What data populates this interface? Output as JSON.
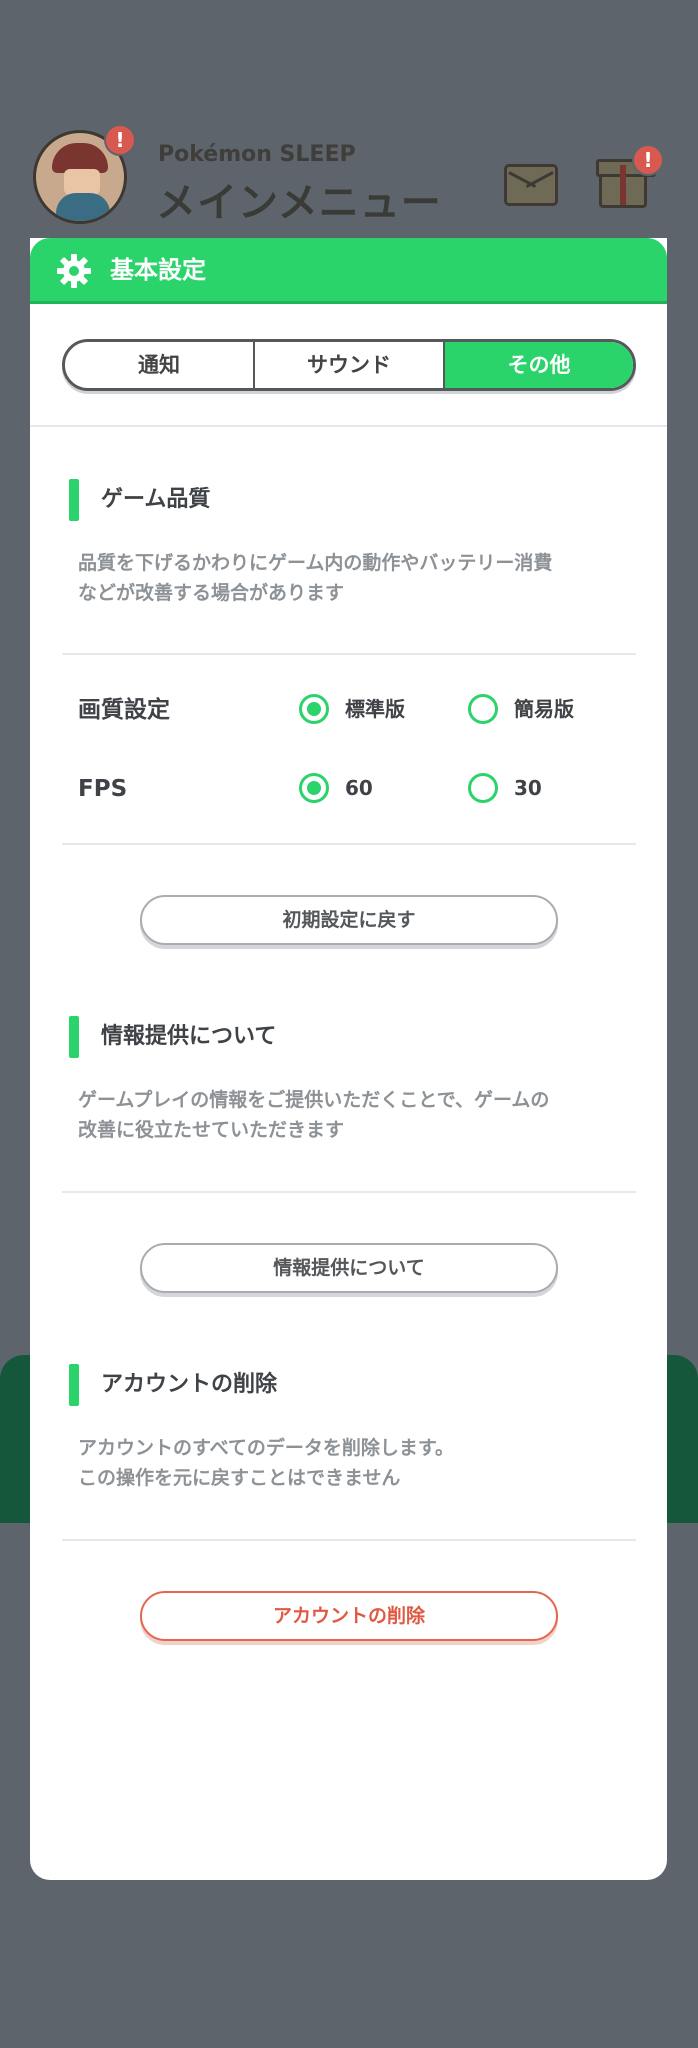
{
  "header": {
    "app_subtitle": "Pokémon SLEEP",
    "title": "メインメニュー",
    "avatar_badge": "!",
    "gift_badge": "!"
  },
  "panel": {
    "title": "基本設定",
    "tabs": [
      {
        "label": "通知",
        "active": false
      },
      {
        "label": "サウンド",
        "active": false
      },
      {
        "label": "その他",
        "active": true
      }
    ]
  },
  "game_quality": {
    "title": "ゲーム品質",
    "description": "品質を下げるかわりにゲーム内の動作やバッテリー消費\nなどが改善する場合があります",
    "image_quality": {
      "label": "画質設定",
      "options": [
        {
          "label": "標準版",
          "selected": true
        },
        {
          "label": "簡易版",
          "selected": false
        }
      ]
    },
    "fps": {
      "label": "FPS",
      "options": [
        {
          "label": "60",
          "selected": true
        },
        {
          "label": "30",
          "selected": false
        }
      ]
    },
    "reset_button": "初期設定に戻す"
  },
  "info_provision": {
    "title": "情報提供について",
    "description": "ゲームプレイの情報をご提供いただくことで、ゲームの\n改善に役立たせていただきます",
    "button": "情報提供について"
  },
  "account_delete": {
    "title": "アカウントの削除",
    "description": "アカウントのすべてのデータを削除します。\nこの操作を元に戻すことはできません",
    "button": "アカウントの削除"
  },
  "colors": {
    "accent": "#2bd36b",
    "danger": "#e05a43",
    "background": "#5d646b"
  }
}
